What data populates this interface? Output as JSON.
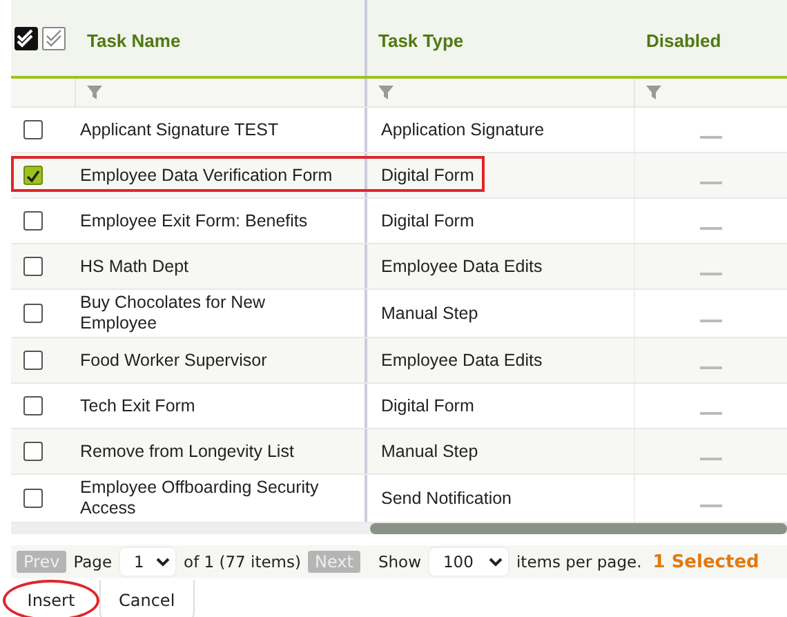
{
  "table": {
    "columns": [
      "Task Name",
      "Task Type",
      "Disabled"
    ],
    "rows": [
      {
        "name": "Applicant Signature TEST",
        "type": "Application Signature",
        "checked": false,
        "disabled": false
      },
      {
        "name": "Employee Data Verification Form",
        "type": "Digital Form",
        "checked": true,
        "disabled": false
      },
      {
        "name": "Employee Exit Form: Benefits",
        "type": "Digital Form",
        "checked": false,
        "disabled": false
      },
      {
        "name": "HS Math Dept",
        "type": "Employee Data Edits",
        "checked": false,
        "disabled": false
      },
      {
        "name": "Buy Chocolates for New Employee",
        "type": "Manual Step",
        "checked": false,
        "disabled": false
      },
      {
        "name": "Food Worker Supervisor",
        "type": "Employee Data Edits",
        "checked": false,
        "disabled": false
      },
      {
        "name": "Tech Exit Form",
        "type": "Digital Form",
        "checked": false,
        "disabled": false
      },
      {
        "name": "Remove from Longevity List",
        "type": "Manual Step",
        "checked": false,
        "disabled": false
      },
      {
        "name": "Employee Offboarding Security Access",
        "type": "Send Notification",
        "checked": false,
        "disabled": false
      }
    ]
  },
  "pager": {
    "prev": "Prev",
    "page_label": "Page",
    "page": "1",
    "of": "of 1 (77 items)",
    "next": "Next",
    "show_label": "Show",
    "per_page": "100",
    "per_page_suffix": "items per page.",
    "selected_count": "1 Selected"
  },
  "buttons": [
    {
      "label": "Insert",
      "circled": true
    },
    {
      "label": "Cancel",
      "circled": false
    }
  ]
}
